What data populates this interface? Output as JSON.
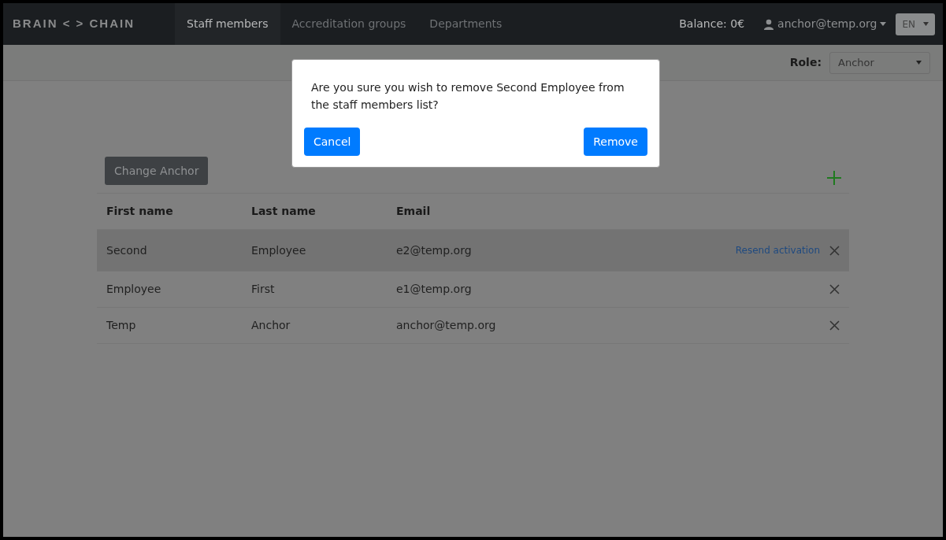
{
  "navbar": {
    "logo": "BRAIN < > CHAIN",
    "tabs": [
      {
        "label": "Staff members",
        "selected": true
      },
      {
        "label": "Accreditation groups",
        "selected": false
      },
      {
        "label": "Departments",
        "selected": false
      }
    ],
    "balance": "Balance: 0€",
    "user": "anchor@temp.org",
    "language": "EN"
  },
  "role": {
    "label": "Role:",
    "value": "Anchor"
  },
  "change_anchor_button": "Change Anchor",
  "table": {
    "columns": [
      "First name",
      "Last name",
      "Email"
    ],
    "rows": [
      {
        "cells": [
          "Second",
          "Employee",
          "e2@temp.org"
        ],
        "highlighted": true,
        "link": "Resend activation"
      },
      {
        "cells": [
          "Employee",
          "First",
          "e1@temp.org"
        ],
        "highlighted": false
      },
      {
        "cells": [
          "Temp",
          "Anchor",
          "anchor@temp.org"
        ],
        "highlighted": false
      }
    ]
  },
  "dialog": {
    "message": "Are you sure you wish to remove Second Employee from the staff members list?",
    "buttons": [
      "Cancel",
      "Remove"
    ]
  }
}
